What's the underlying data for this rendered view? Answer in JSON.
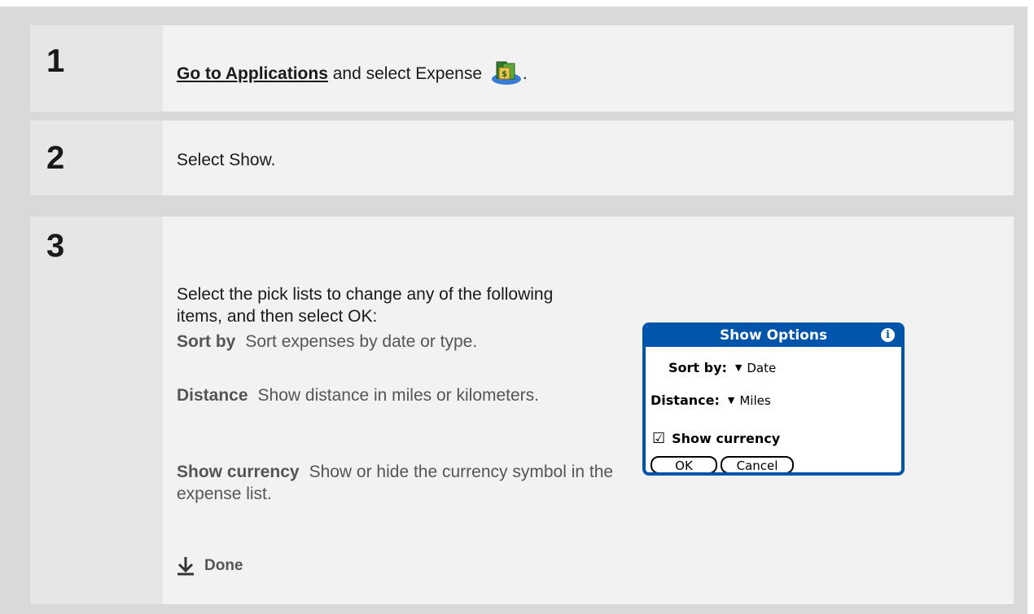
{
  "steps": [
    {
      "number": "1",
      "link": "Go to Applications",
      "text": " and select Expense ",
      "trail": "."
    },
    {
      "number": "2",
      "text": "Select Show."
    },
    {
      "number": "3",
      "intro": "Select the pick lists to change any of the following items, and then select OK:",
      "items": [
        {
          "term": "Sort by",
          "desc": "Sort expenses by date or type."
        },
        {
          "term": "Distance",
          "desc": "Show distance in miles or kilometers."
        },
        {
          "term": "Show currency",
          "desc": "Show or hide the currency symbol in the expense list."
        }
      ],
      "done": "Done"
    }
  ],
  "dialog": {
    "title": "Show Options",
    "sort_label": "Sort by:",
    "sort_value": "Date",
    "distance_label": "Distance:",
    "distance_value": "Miles",
    "checkbox_label": "Show currency",
    "checkbox_checked": true,
    "ok": "OK",
    "cancel": "Cancel"
  },
  "icons": {
    "expense": "expense-app-icon",
    "info": "info-icon",
    "done": "down-arrow-icon",
    "dropdown": "triangle-down-icon"
  }
}
